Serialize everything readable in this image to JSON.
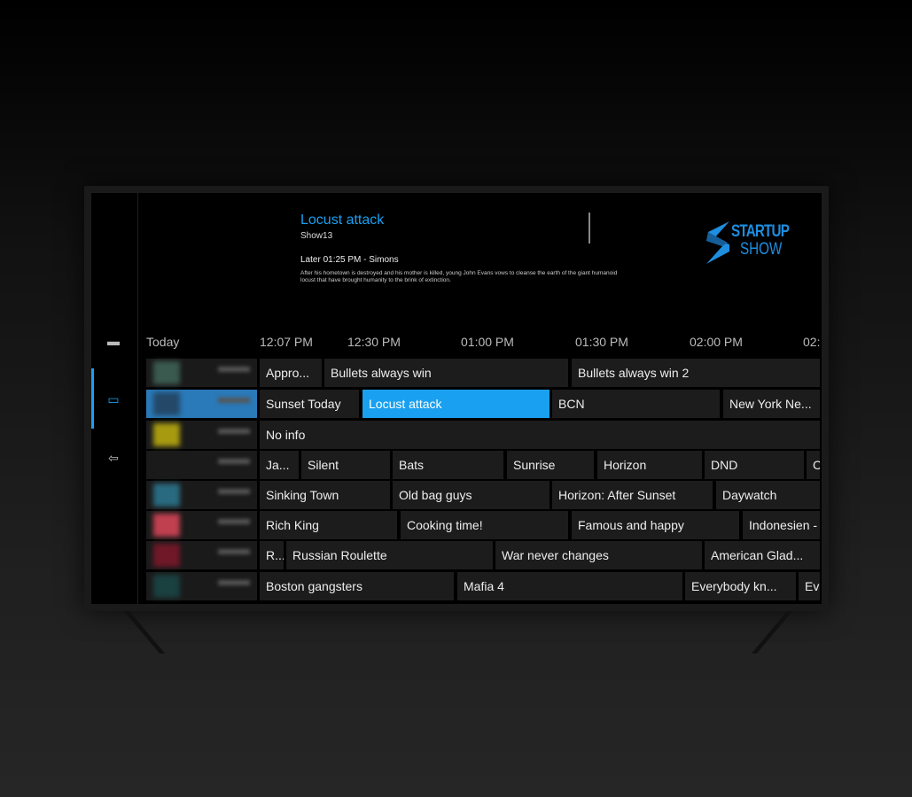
{
  "info": {
    "title": "Locust attack",
    "subtitle": "Show13",
    "later": "Later 01:25 PM - Simons",
    "description": "After his hometown is destroyed and his mother is killed, young John Evans vows to cleanse the earth of the giant humanoid locust that have brought humanity to the brink of extinction."
  },
  "logo": {
    "line1": "STARTUP",
    "line2": "SHOW",
    "color": "#1e8ee0"
  },
  "sidebar": {
    "items": [
      {
        "icon": "tv-icon",
        "active": false
      },
      {
        "icon": "live-tv-icon",
        "active": true
      },
      {
        "icon": "exit-icon",
        "active": false
      }
    ]
  },
  "accent": "#1aa0f0",
  "timeline": {
    "day": "Today",
    "times": [
      "12:07 PM",
      "12:30 PM",
      "01:00 PM",
      "01:30 PM",
      "02:00 PM",
      "02:"
    ]
  },
  "guide": {
    "rows": [
      {
        "channel_color": "#3a5a50",
        "programs": [
          "Appro...",
          "Bullets always win",
          "Bullets always win 2"
        ]
      },
      {
        "channel_color": "#244868",
        "selected_channel": true,
        "programs": [
          "Sunset Today",
          "Locust attack",
          "BCN",
          "New York Ne..."
        ],
        "selected_program": 1
      },
      {
        "channel_color": "#a89a10",
        "programs": [
          "No info"
        ]
      },
      {
        "channel_color": "#1a1a1a",
        "programs": [
          "Ja...",
          "Silent",
          "Bats",
          "Sunrise",
          "Horizon",
          "DND",
          "C"
        ]
      },
      {
        "channel_color": "#2a6a80",
        "programs": [
          "Sinking Town",
          "Old bag guys",
          "Horizon: After Sunset",
          "Daywatch"
        ]
      },
      {
        "channel_color": "#c04050",
        "programs": [
          "Rich King",
          "Cooking time!",
          "Famous and happy",
          "Indonesien -"
        ]
      },
      {
        "channel_color": "#701828",
        "programs": [
          "R...",
          "Russian Roulette",
          "War never changes",
          "American Glad..."
        ]
      },
      {
        "channel_color": "#1a4040",
        "programs": [
          "Boston gangsters",
          "Mafia 4",
          "Everybody kn...",
          "Ev"
        ]
      }
    ]
  }
}
